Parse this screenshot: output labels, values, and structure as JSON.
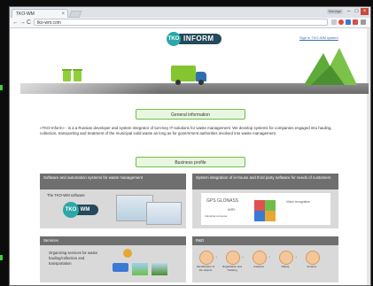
{
  "browser": {
    "tab_title": "TKO-WM",
    "tab_close": "×",
    "url": "tko-wm.com",
    "user_badge": "Manage",
    "window_controls": [
      "–",
      "□",
      "×"
    ],
    "nav": {
      "back": "←",
      "forward": "→",
      "reload": "C"
    }
  },
  "header": {
    "logo_circle": "TKO",
    "logo_text": "INFORM",
    "top_link": "Sign in TKO-WM system"
  },
  "sections": {
    "general": "General information",
    "business": "Business profile"
  },
  "intro_text": "«TKO-Inform» - is a a Russian developer and system integrator of turn-key IT-solutions for waste management. We develop systems for companies engaged into hauling, collection, transporting and treatment of the municipal solid waste as long as for government authorities involved into waste management.",
  "cards": [
    {
      "title": "Software and automation systems for waste management",
      "sub": "The TKO-WM software",
      "logo_a": "TKO",
      "logo_b": "WM"
    },
    {
      "title": "System integration of in-house and third party software for needs of customers",
      "words": [
        "GPS GLONASS",
        "Industrial computer",
        "WIFI",
        "Video recognition"
      ]
    },
    {
      "title": "Services",
      "desc": "Organizing services for waste hauling/collection and transportation"
    },
    {
      "title": "R&D",
      "steps": [
        "Identification of the objects",
        "Registration and Tracking",
        "Analytics",
        "Rating",
        "Finance"
      ]
    }
  ],
  "colors": {
    "brand_teal": "#2aa8a6",
    "brand_navy": "#244a5b",
    "accent_green": "#84c530",
    "section_border": "#6dbf4a"
  }
}
